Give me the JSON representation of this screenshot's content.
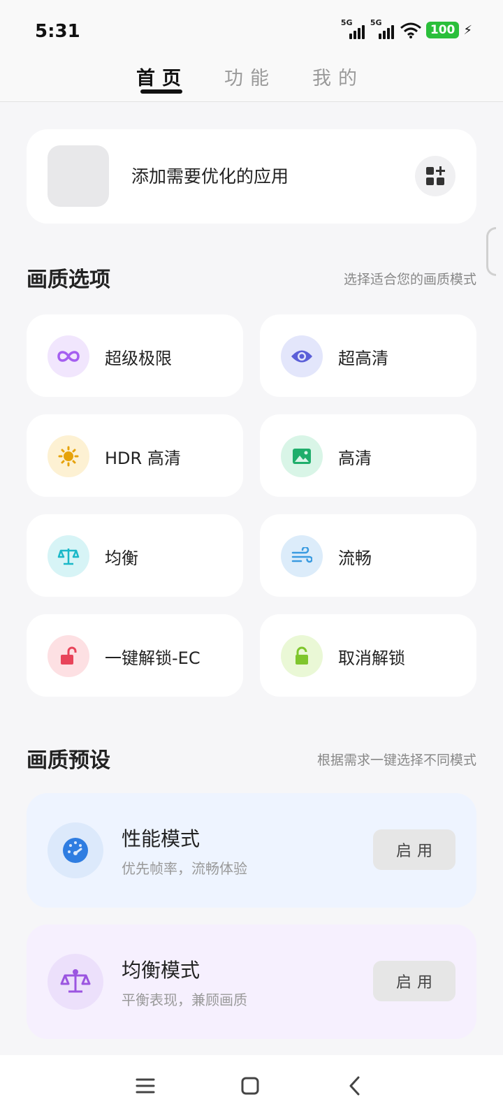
{
  "status": {
    "time": "5:31",
    "sim1": "5G",
    "sim2": "5G",
    "battery": "100"
  },
  "tabs": [
    {
      "label": "首页"
    },
    {
      "label": "功能"
    },
    {
      "label": "我的"
    }
  ],
  "add_app": {
    "text": "添加需要优化的应用"
  },
  "quality_options": {
    "title": "画质选项",
    "subtitle": "选择适合您的画质模式",
    "items": [
      {
        "label": "超级极限",
        "icon": "infinity-icon",
        "icon_color": "#a55ff0",
        "bg": "#f1e6fd"
      },
      {
        "label": "超高清",
        "icon": "eye-icon",
        "icon_color": "#5b5fd8",
        "bg": "#e3e6fb"
      },
      {
        "label": "HDR 高清",
        "icon": "sun-icon",
        "icon_color": "#e6a20a",
        "bg": "#fdf1d3"
      },
      {
        "label": "高清",
        "icon": "image-icon",
        "icon_color": "#1fae6b",
        "bg": "#d9f5e7"
      },
      {
        "label": "均衡",
        "icon": "scale-icon",
        "icon_color": "#1ab8c8",
        "bg": "#d7f4f6"
      },
      {
        "label": "流畅",
        "icon": "wind-icon",
        "icon_color": "#3a9be0",
        "bg": "#dcecfa"
      },
      {
        "label": "一键解锁-EC",
        "icon": "unlock-icon",
        "icon_color": "#e8445a",
        "bg": "#fde0e3"
      },
      {
        "label": "取消解锁",
        "icon": "lock-open-icon",
        "icon_color": "#7fc62d",
        "bg": "#eaf8d6"
      }
    ]
  },
  "presets": {
    "title": "画质预设",
    "subtitle": "根据需求一键选择不同模式",
    "items": [
      {
        "title": "性能模式",
        "desc": "优先帧率，流畅体验",
        "button": "启用",
        "icon": "speedometer-icon",
        "icon_color": "#2f7de1",
        "bg": "#eef4ff",
        "icon_bg": "#dce9fb"
      },
      {
        "title": "均衡模式",
        "desc": "平衡表现，兼顾画质",
        "button": "启用",
        "icon": "scale-icon",
        "icon_color": "#9b55e0",
        "bg": "#f6f0fe",
        "icon_bg": "#ece0fb"
      }
    ]
  }
}
